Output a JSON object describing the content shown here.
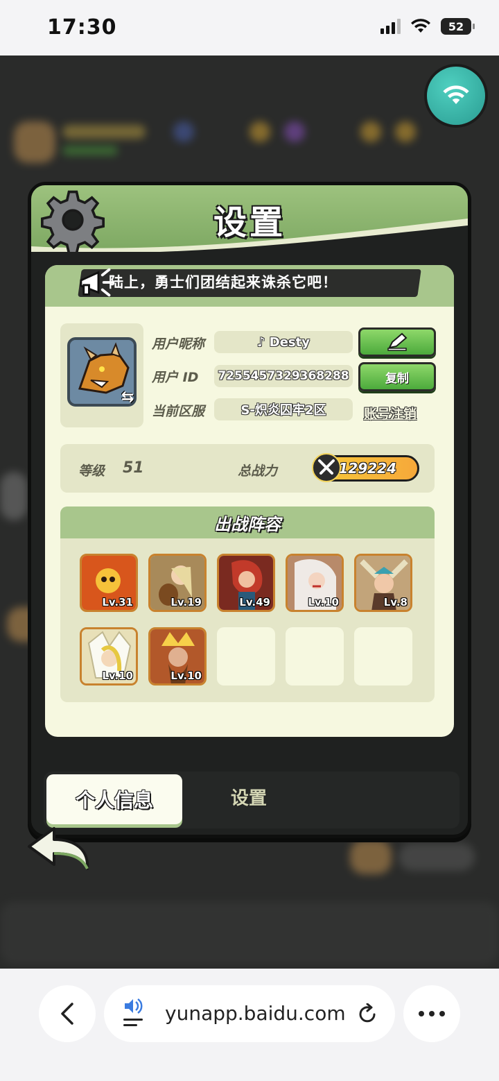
{
  "status_bar": {
    "time": "17:30",
    "battery": "52"
  },
  "panel": {
    "title": "设置"
  },
  "announcement": {
    "text": "陆上，勇士们团结起来诛杀它吧！"
  },
  "profile": {
    "nickname_label": "用户昵称",
    "nickname": "♪ Desty",
    "id_label": "用户  ID",
    "id": "7255457329368288",
    "copy_label": "复制",
    "server_label": "当前区服",
    "server": "S-炽炎囚牢2区",
    "cancel_account_label": "账号注销"
  },
  "stats": {
    "level_label": "等级",
    "level": "51",
    "power_label": "总战力",
    "power": "129224"
  },
  "lineup": {
    "title": "出战阵容",
    "heroes": [
      {
        "level": "Lv.31",
        "color": "#d8561c"
      },
      {
        "level": "Lv.19",
        "color": "#a88a5a"
      },
      {
        "level": "Lv.49",
        "color": "#b23a2a"
      },
      {
        "level": "Lv.10",
        "color": "#c8c4c0"
      },
      {
        "level": "Lv.8",
        "color": "#c2a47a"
      },
      {
        "level": "Lv.10",
        "color": "#e8e0b8"
      },
      {
        "level": "Lv.10",
        "color": "#b2582a"
      }
    ],
    "empty_slots": 3
  },
  "tabs": {
    "personal_info": "个人信息",
    "settings": "设置"
  },
  "browser": {
    "url": "yunapp.baidu.com"
  },
  "colors": {
    "panel_green": "#9dc27e",
    "content_bg": "#f6f8e0",
    "button_green": "#4caa3c",
    "power_gold": "#f7c83a"
  }
}
